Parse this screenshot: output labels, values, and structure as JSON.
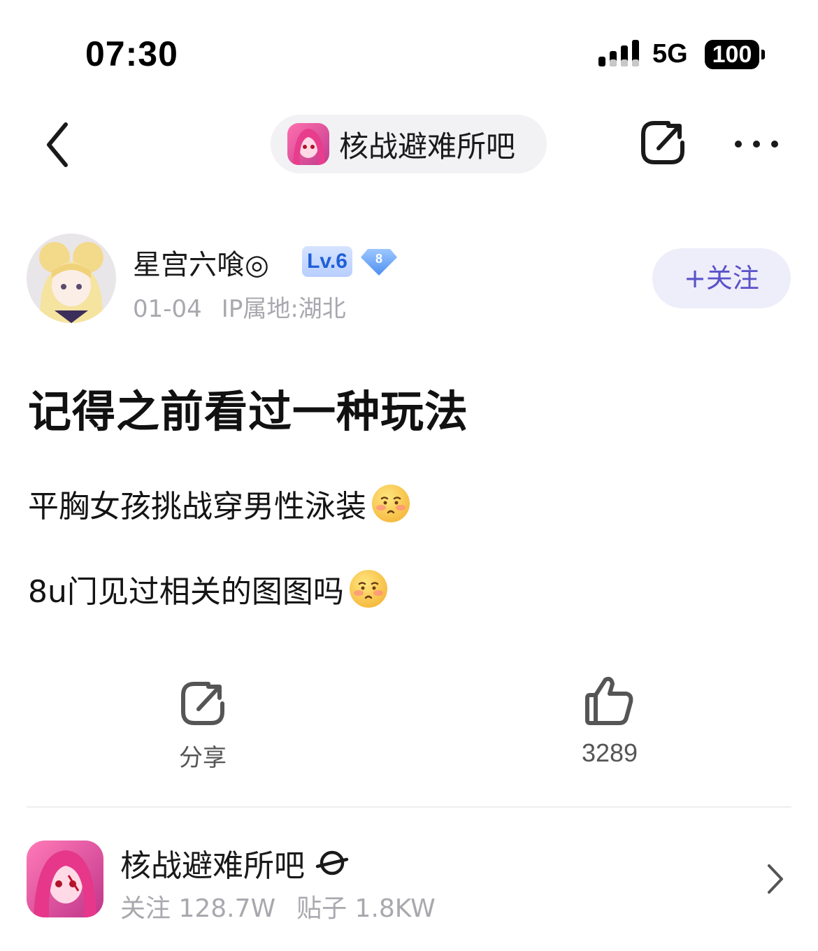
{
  "status_bar": {
    "time": "07:30",
    "network": "5G",
    "battery": "100"
  },
  "nav": {
    "forum_name": "核战避难所吧"
  },
  "author": {
    "name": "星宫六喰◎",
    "level": "Lv.6",
    "diamond_level": "8",
    "date": "01-04",
    "ip_location": "IP属地:湖北",
    "follow_label": "+关注"
  },
  "post": {
    "title": "记得之前看过一种玩法",
    "paragraphs": [
      "平胸女孩挑战穿男性泳装",
      "8u门见过相关的图图吗"
    ]
  },
  "actions": {
    "share_label": "分享",
    "like_count": "3289"
  },
  "forum_card": {
    "name": "核战避难所吧",
    "followers": "关注 128.7W",
    "posts": "贴子 1.8KW"
  },
  "icons": {
    "back": "chevron-left-icon",
    "share": "share-icon",
    "more": "more-icon",
    "like": "thumbs-up-icon",
    "planet": "planet-icon",
    "chevron": "chevron-right-icon",
    "emoji": "blushing-face-emoji"
  },
  "colors": {
    "follow_accent": "#5a52c9",
    "level_badge": "#1f5fd6",
    "meta_gray": "#a8a8ae"
  }
}
